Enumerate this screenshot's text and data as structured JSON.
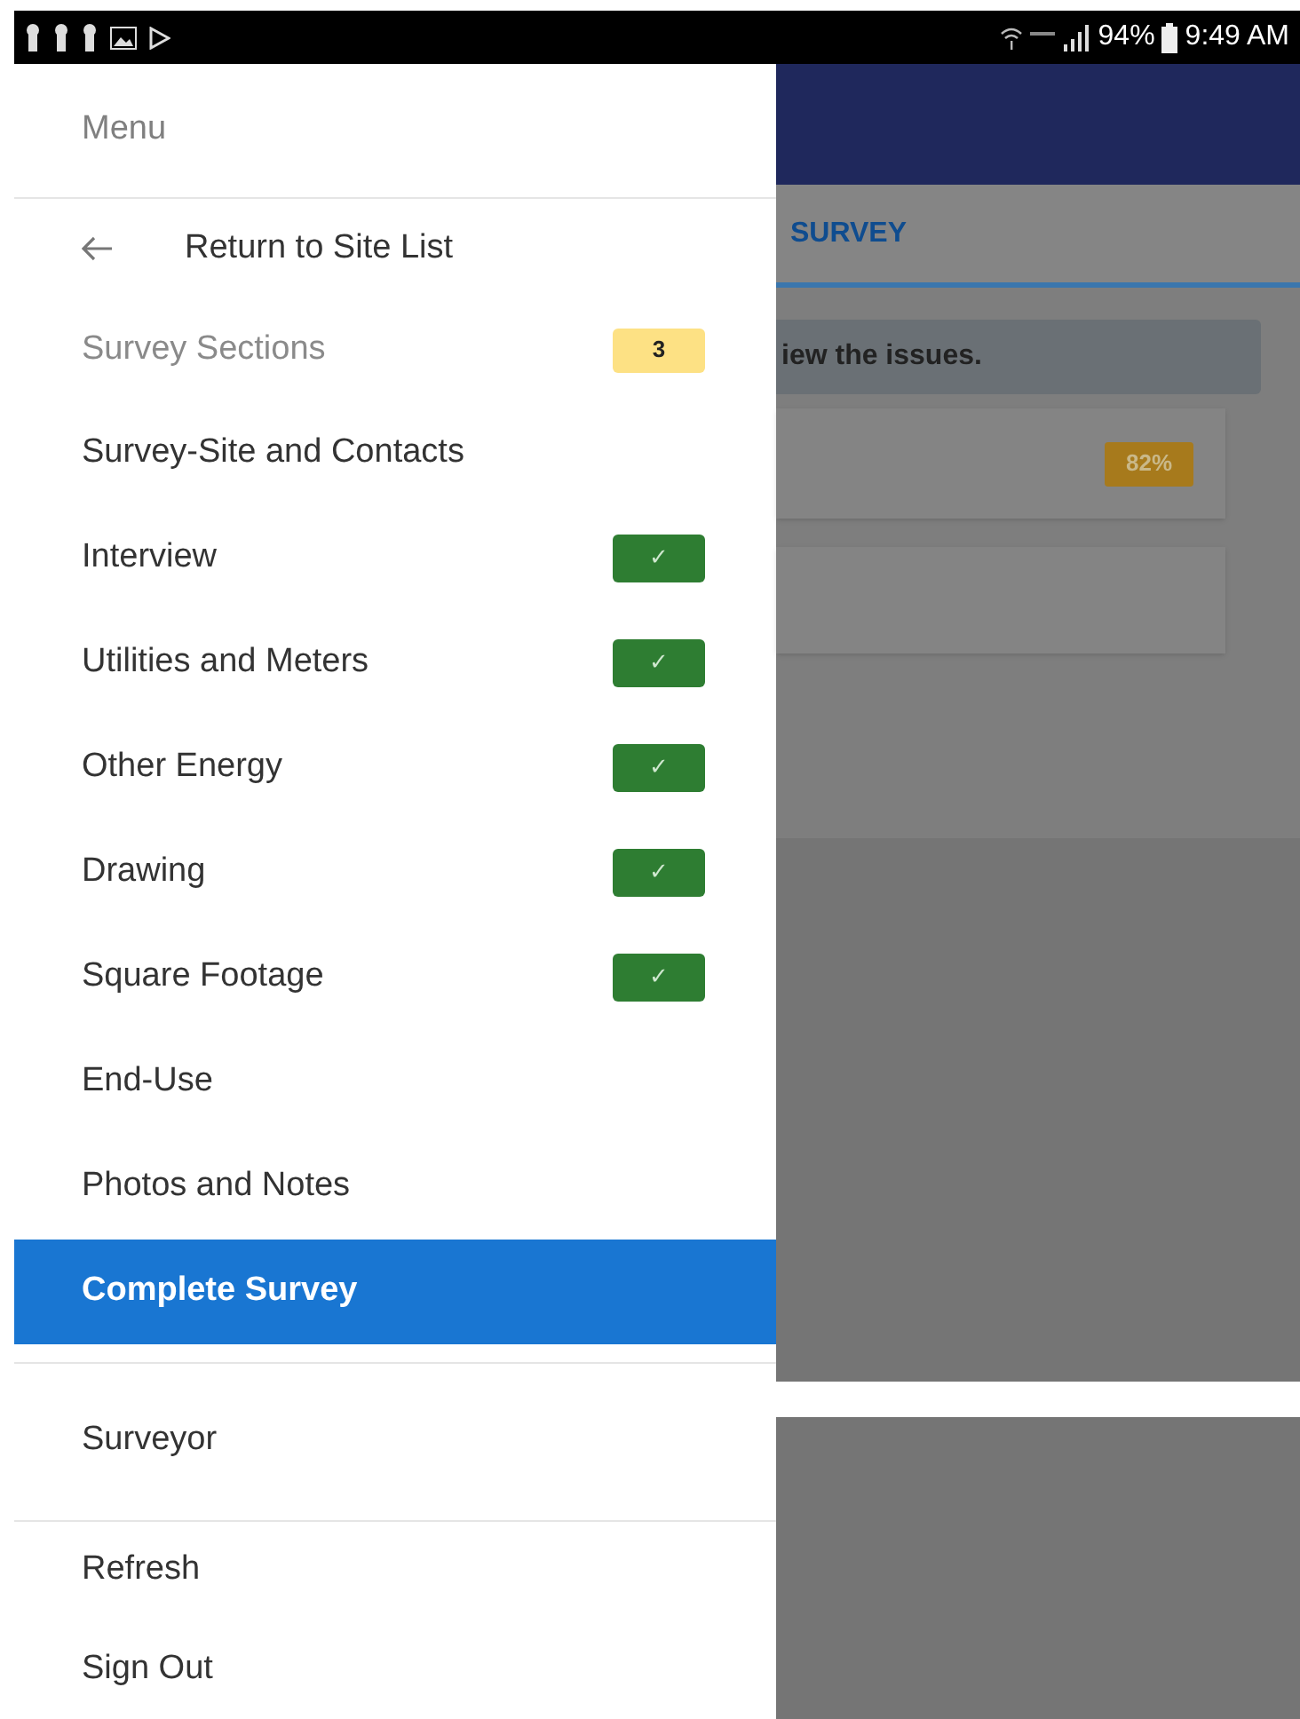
{
  "status_bar": {
    "battery": "94%",
    "time": "9:49 AM"
  },
  "menu": {
    "title": "Menu",
    "back": "Return to Site List",
    "sections_label": "Survey Sections",
    "sections_count": "3",
    "sections": [
      {
        "label": "Survey-Site and Contacts",
        "completed": false,
        "selected": false
      },
      {
        "label": "Interview",
        "completed": true,
        "selected": false
      },
      {
        "label": "Utilities and Meters",
        "completed": true,
        "selected": false
      },
      {
        "label": "Other Energy",
        "completed": true,
        "selected": false
      },
      {
        "label": "Drawing",
        "completed": true,
        "selected": false
      },
      {
        "label": "Square Footage",
        "completed": true,
        "selected": false
      },
      {
        "label": "End-Use",
        "completed": false,
        "selected": false
      },
      {
        "label": "Photos and Notes",
        "completed": false,
        "selected": false
      },
      {
        "label": "Complete Survey",
        "completed": false,
        "selected": true
      }
    ],
    "check_mark": "✓",
    "footer_items": [
      "Surveyor",
      "Refresh",
      "Sign Out"
    ]
  },
  "background": {
    "tab": "SURVEY",
    "notice": "iew the issues.",
    "progress_badge": "82%"
  }
}
